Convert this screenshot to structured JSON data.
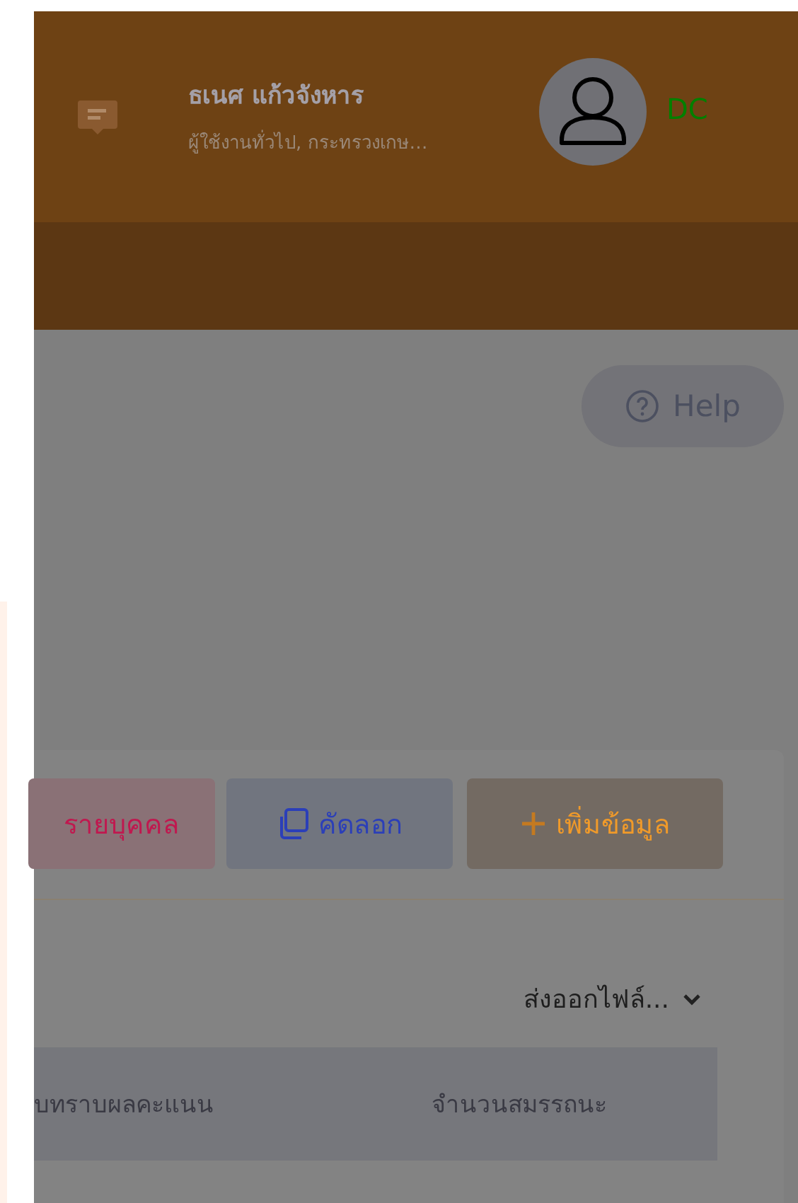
{
  "header": {
    "user_name": "ธเนศ แก้วจังหาร",
    "user_role": "ผู้ใช้งานทั่วไป, กระทรวงเกษ…",
    "badge": "DC"
  },
  "help_button": {
    "label": "Help"
  },
  "actions": [
    {
      "label": "รายบุคคล",
      "kind": "report"
    },
    {
      "label": "คัดลอก",
      "kind": "copy"
    },
    {
      "label": "เพิ่มข้อมูล",
      "kind": "add"
    }
  ],
  "export_menu": {
    "label": "ส่งออกไฟล์..."
  },
  "table": {
    "columns": [
      "บทราบผลคะแนน",
      "จำนวนสมรรถนะ"
    ]
  }
}
